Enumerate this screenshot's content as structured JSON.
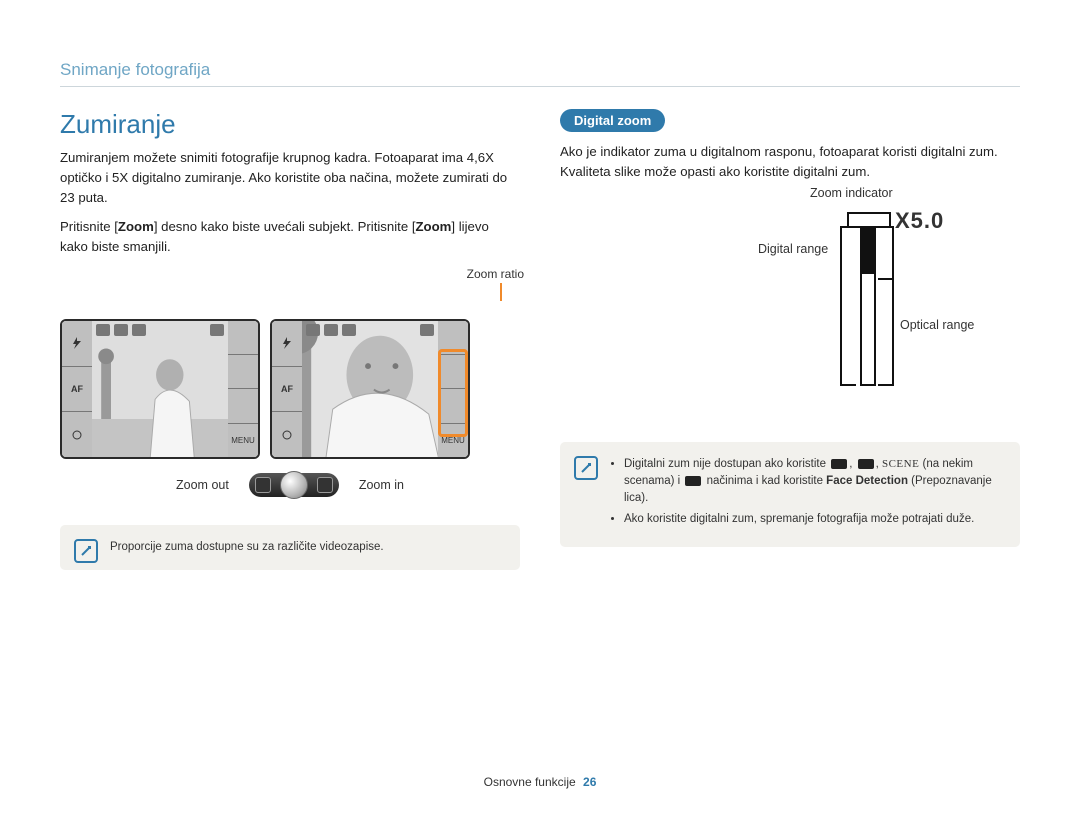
{
  "header": {
    "breadcrumb": "Snimanje fotografija"
  },
  "left": {
    "title": "Zumiranje",
    "p1": "Zumiranjem možete snimiti fotografije krupnog kadra. Fotoaparat ima 4,6X optičko i 5X digitalno zumiranje. Ako koristite oba načina, možete zumirati do 23 puta.",
    "p2a": "Pritisnite [",
    "p2b": "Zoom",
    "p2c": "] desno kako biste uvećali subjekt. Pritisnite [",
    "p2d": "Zoom",
    "p2e": "] lijevo kako biste smanjili.",
    "zoom_ratio_label": "Zoom ratio",
    "zoom_out": "Zoom out",
    "zoom_in": "Zoom in",
    "note": "Proporcije zuma dostupne su za različite videozapise."
  },
  "right": {
    "pill": "Digital zoom",
    "p1": "Ako je indikator zuma u digitalnom rasponu, fotoaparat koristi digitalni zum. Kvaliteta slike može opasti ako koristite digitalni zum.",
    "zoom_indicator": "Zoom indicator",
    "digital_range": "Digital range",
    "optical_range": "Optical range",
    "x50": "X5.0",
    "note_li1a": "Digitalni zum nije dostupan ako koristite ",
    "note_li1b": " (na nekim scenama) i ",
    "note_li1c": " načinima i kad koristite ",
    "note_li1_fd": "Face Detection",
    "note_li1d": " (Prepoznavanje lica).",
    "note_scene": "SCENE",
    "note_li2": "Ako koristite digitalni zum, spremanje fotografija može potrajati duže."
  },
  "footer": {
    "section": "Osnovne funkcije",
    "page": "26"
  }
}
